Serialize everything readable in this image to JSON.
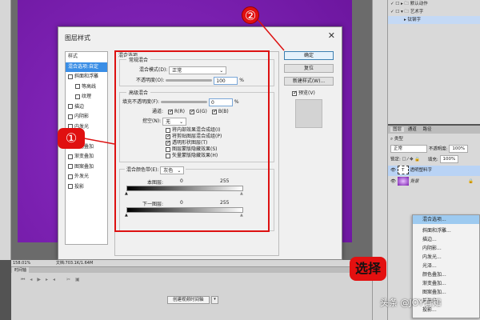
{
  "dialog": {
    "title": "图层样式",
    "close": "✕",
    "styles_header": "样式",
    "styles": [
      {
        "label": "混合选项:自定",
        "selected": true
      },
      {
        "label": "斜面和浮雕",
        "checked": false
      },
      {
        "label": "等高线",
        "checked": false,
        "indent": true
      },
      {
        "label": "纹理",
        "checked": false,
        "indent": true
      },
      {
        "label": "描边",
        "checked": false
      },
      {
        "label": "内阴影",
        "checked": false
      },
      {
        "label": "内发光",
        "checked": false
      },
      {
        "label": "光泽",
        "checked": false
      },
      {
        "label": "颜色叠加",
        "checked": false
      },
      {
        "label": "渐变叠加",
        "checked": false
      },
      {
        "label": "图案叠加",
        "checked": false
      },
      {
        "label": "外发光",
        "checked": false
      },
      {
        "label": "投影",
        "checked": false
      }
    ],
    "section_title": "混合选项",
    "general": {
      "legend": "常规混合",
      "blend_mode_label": "混合模式(D):",
      "blend_mode": "正常",
      "opacity_label": "不透明度(O):",
      "opacity": "100",
      "unit": "%"
    },
    "advanced": {
      "legend": "高级混合",
      "fill_label": "填充不透明度(F):",
      "fill": "0",
      "unit": "%",
      "channels_label": "通道:",
      "channels": [
        {
          "label": "R(R)",
          "checked": true
        },
        {
          "label": "G(G)",
          "checked": true
        },
        {
          "label": "B(B)",
          "checked": true
        }
      ],
      "knockout_label": "挖空(N):",
      "knockout": "无",
      "options": [
        {
          "label": "将内部效果混合成组(I)",
          "checked": false
        },
        {
          "label": "将剪贴图层混合成组(P)",
          "checked": true
        },
        {
          "label": "透明形状图层(T)",
          "checked": true
        },
        {
          "label": "图层蒙版隐藏效果(S)",
          "checked": false
        },
        {
          "label": "矢量蒙版隐藏效果(H)",
          "checked": false
        }
      ]
    },
    "blend_if": {
      "label": "混合颜色带(E):",
      "value": "灰色",
      "this_layer": "本图层:",
      "underlying": "下一图层:",
      "min": "0",
      "max": "255"
    },
    "buttons": {
      "ok": "确定",
      "reset": "复位",
      "new_style": "新建样式(W)...",
      "preview": "预览(V)",
      "preview_checked": true
    }
  },
  "annotations": {
    "circle1": "①",
    "circle2": "②",
    "select": "选择"
  },
  "actions_panel": {
    "rows": [
      "默认动作",
      "艺术字",
      "钛钢字"
    ]
  },
  "layers_panel": {
    "tabs": [
      "图层",
      "通道",
      "路径"
    ],
    "filter": "类型",
    "blend": "正常",
    "opacity_label": "不透明度:",
    "opacity": "100%",
    "lock_label": "锁定:",
    "fill_label": "填充:",
    "fill": "100%",
    "layers": [
      {
        "name": "透明塑料字",
        "type": "T",
        "selected": true
      },
      {
        "name": "背景",
        "locked": true
      }
    ]
  },
  "context_menu": {
    "items": [
      "混合选项...",
      "斜面和浮雕...",
      "描边...",
      "内阴影...",
      "内发光...",
      "光泽...",
      "颜色叠加...",
      "渐变叠加...",
      "图案叠加...",
      "外发光...",
      "投影..."
    ],
    "highlighted": 0
  },
  "status": {
    "zoom": "158.01%",
    "doc": "文档:703.1K/1.64M"
  },
  "timeline": {
    "tab": "时间轴",
    "create_button": "创建视频时间轴"
  },
  "watermark": "头条 @JOY有知",
  "colors": {
    "accent": "#3a8ee6",
    "annotation_red": "#e01010",
    "canvas": "#7b1fb0"
  }
}
